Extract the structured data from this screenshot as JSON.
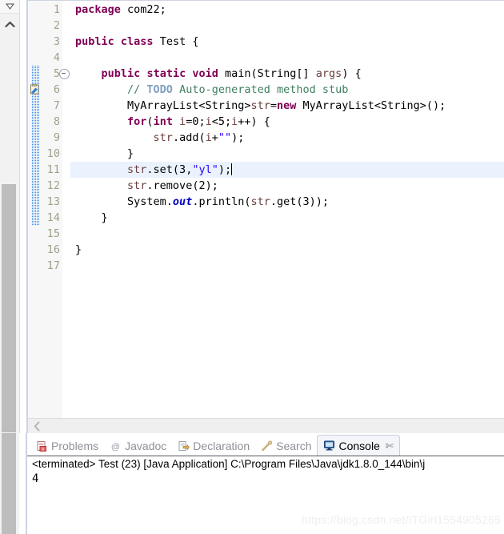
{
  "left_rail": {
    "restore_icon": "restore-triangle-icon",
    "chevron_icon": "chevron-up-icon"
  },
  "editor": {
    "font_size": 13.5,
    "current_line": 11,
    "fold_lines": [
      5
    ],
    "todo_marker_line": 6,
    "change_bar_from": 5,
    "change_bar_to": 14,
    "scroll_left_icon": "scroll-left-chevron-icon",
    "line_numbers": [
      "1",
      "2",
      "3",
      "4",
      "5",
      "6",
      "7",
      "8",
      "9",
      "10",
      "11",
      "12",
      "13",
      "14",
      "15",
      "16",
      "17"
    ],
    "lines": [
      {
        "n": "1",
        "text": "package com22;"
      },
      {
        "n": "2",
        "text": ""
      },
      {
        "n": "3",
        "text": "public class Test {"
      },
      {
        "n": "4",
        "text": ""
      },
      {
        "n": "5",
        "text": "    public static void main(String[] args) {"
      },
      {
        "n": "6",
        "text": "        // TODO Auto-generated method stub"
      },
      {
        "n": "7",
        "text": "        MyArrayList<String>str=new MyArrayList<String>();"
      },
      {
        "n": "8",
        "text": "        for(int i=0;i<5;i++) {"
      },
      {
        "n": "9",
        "text": "            str.add(i+\"\");"
      },
      {
        "n": "10",
        "text": "        }"
      },
      {
        "n": "11",
        "text": "        str.set(3,\"yl\");"
      },
      {
        "n": "12",
        "text": "        str.remove(2);"
      },
      {
        "n": "13",
        "text": "        System.out.println(str.get(3));"
      },
      {
        "n": "14",
        "text": "    }"
      },
      {
        "n": "15",
        "text": ""
      },
      {
        "n": "16",
        "text": "}"
      },
      {
        "n": "17",
        "text": ""
      }
    ]
  },
  "bottom_panel": {
    "tabs": [
      {
        "label": "Problems",
        "icon": "problems-icon",
        "active": false,
        "closable": false
      },
      {
        "label": "Javadoc",
        "icon": "javadoc-icon",
        "active": false,
        "closable": false
      },
      {
        "label": "Declaration",
        "icon": "declaration-icon",
        "active": false,
        "closable": false
      },
      {
        "label": "Search",
        "icon": "search-icon",
        "active": false,
        "closable": false
      },
      {
        "label": "Console",
        "icon": "console-icon",
        "active": true,
        "closable": true
      }
    ],
    "close_glyph": "✄",
    "console": {
      "header": "<terminated> Test (23) [Java Application] C:\\Program Files\\Java\\jdk1.8.0_144\\bin\\j",
      "output": "4",
      "watermark": "https://blog.csdn.net/ITGirl1554905265"
    }
  },
  "colors": {
    "keyword": "#7f0055",
    "string": "#2a00ff",
    "comment": "#3f7f5f",
    "todo": "#7f9fbf",
    "field": "#0000c0",
    "local": "#6a3e3e",
    "current_line_bg": "#eaf2fd",
    "change_bar": "#3f8fe0",
    "line_number": "#a0a08c",
    "tab_inactive": "#8d9096",
    "watermark": "#eeeeee"
  }
}
